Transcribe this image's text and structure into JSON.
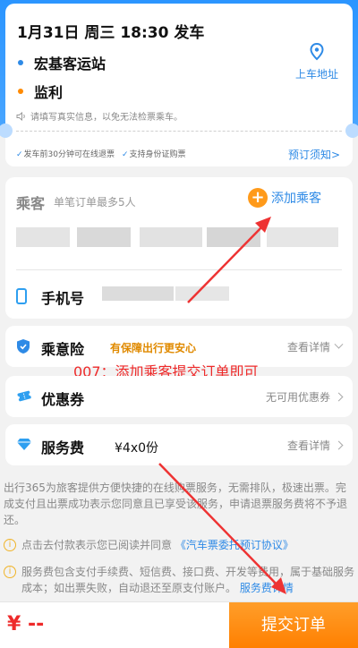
{
  "trip": {
    "title": "1月31日 周三 18:30 发车",
    "from_station": "宏基客运站",
    "to_station": "监利",
    "boarding_address": "上车地址",
    "notice": "请填写真实信息，以免无法检票乘车。",
    "tags": [
      "发车前30分钟可在线退票",
      "支持身份证购票"
    ],
    "booking_notice": "预订须知>"
  },
  "passenger": {
    "title": "乘客",
    "subtitle": "单笔订单最多5人",
    "add_label": "添加乘客",
    "phone_label": "手机号"
  },
  "insurance": {
    "label": "乘意险",
    "slogan": "有保障出行更安心",
    "action": "查看详情"
  },
  "coupon": {
    "label": "优惠券",
    "value": "无可用优惠券"
  },
  "service_fee": {
    "label": "服务费",
    "value": "¥4x0份",
    "action": "查看详情"
  },
  "annotation": "007：添加乘客提交订单即可",
  "terms": {
    "paragraph": "出行365为旅客提供方便快捷的在线购票服务，无需排队，极速出票。完成支付且出票成功表示您同意且已享受该服务，申请退票服务费将不予退还。",
    "agree_prefix": "点击去付款表示您已阅读并同意",
    "agreement_link": "《汽车票委托预订协议》",
    "fee_note": "服务费包含支付手续费、短信费、接口费、开发等费用，属于基础服务成本；如出票失败，自动退还至原支付账户。",
    "fee_link": "服务费详情"
  },
  "footer": {
    "price": "¥ --",
    "submit_label": "提交订单"
  },
  "colors": {
    "brand_blue": "#2e8ae6",
    "accent_orange": "#ff8a00",
    "price_red": "#ee2a2a"
  }
}
